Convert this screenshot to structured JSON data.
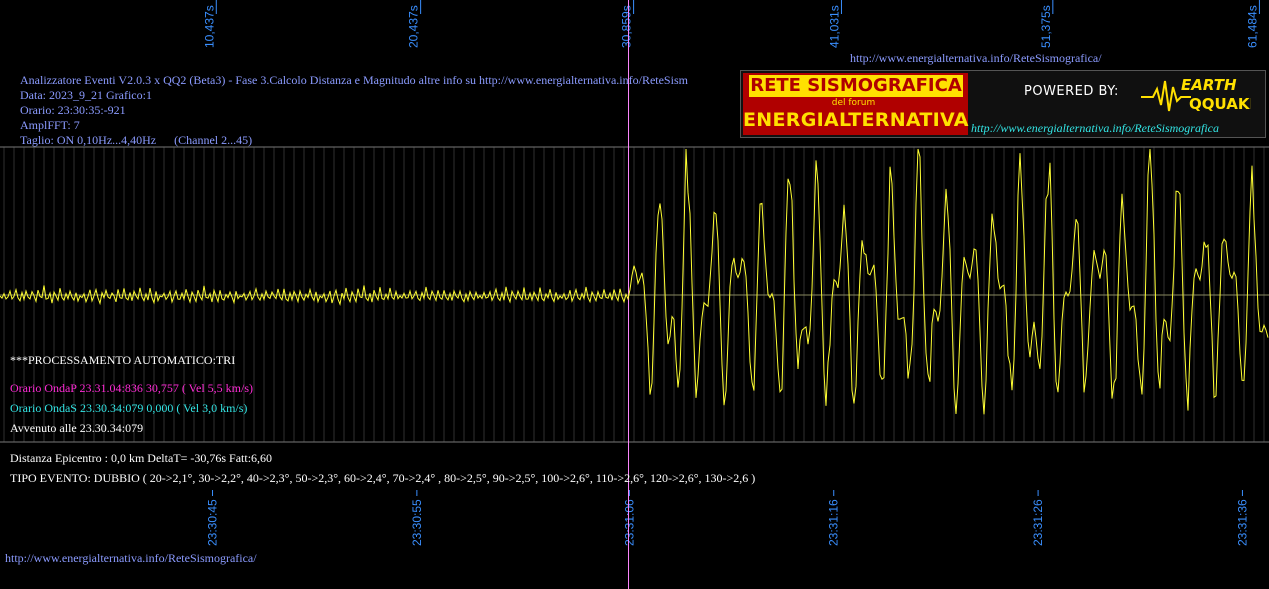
{
  "colors": {
    "background": "#000000",
    "trace": "#ffff33",
    "grid": "#555555",
    "axis_label": "#3a8fff",
    "pwave_marker": "#ff88ff",
    "header_text": "#8b9bff",
    "onda_p": "#ff2bd6",
    "onda_s": "#33e6e6"
  },
  "header": {
    "title": "Analizzatore Eventi V2.0.3 x QQ2 (Beta3) - Fase 3.Calcolo Distanza e Magnitudo altre info su http://www.energialternativa.info/ReteSism",
    "data": "Data: 2023_9_21 Grafico:1",
    "orario": "Orario: 23:30:35:-921",
    "ampl": "AmplFFT: 7",
    "taglio": "Taglio: ON 0,10Hz...4,40Hz      (Channel 2...45)",
    "top_url": "http://www.energialternativa.info/ReteSismografica/"
  },
  "logo": {
    "top": "RETE SISMOGRAFICA",
    "mid": "del forum",
    "bottom": "ENERGIALTERNATIVA",
    "powered": "POWERED BY:",
    "brand_line1": "EARTH",
    "brand_line2": "QQUAKE",
    "url": "http://www.energialternativa.info/ReteSismografica"
  },
  "processing": {
    "auto": "***PROCESSAMENTO AUTOMATICO:TRI",
    "onda_p": "Orario OndaP 23.31.04:836  30,757 ( Vel 5,5 km/s)",
    "onda_s": "Orario OndaS 23.30.34:079  0,000 ( Vel 3,0 km/s)",
    "avvenuto": "Avvenuto alle 23.30.34:079",
    "distanza": "Distanza Epicentro : 0,0 km DeltaT= -30,76s  Fatt:6,60",
    "tipo_evento": "TIPO EVENTO: DUBBIO ( 20->2,1°, 30->2,2°, 40->2,3°, 50->2,3°, 60->2,4°, 70->2,4° , 80->2,5°, 90->2,5°, 100->2,6°, 110->2,6°, 120->2,6°, 130->2,6 )"
  },
  "footer_url": "http://www.energialternativa.info/ReteSismografica/",
  "chart_data": {
    "type": "line",
    "series": [],
    "x_unit": "s",
    "x_range": [
      0,
      62.1
    ],
    "top_ticks": [
      "10,437s",
      "20,437s",
      "30,859s",
      "41,031s",
      "51,375s",
      "61,484s"
    ],
    "top_tick_values": [
      10.437,
      20.437,
      30.859,
      41.031,
      51.375,
      61.484
    ],
    "bottom_ticks": [
      "23:30:45",
      "23:30:55",
      "23:31:06",
      "23:31:16",
      "23:31:26",
      "23:31:36"
    ],
    "bottom_tick_values": [
      10.4,
      20.4,
      30.8,
      40.8,
      50.8,
      60.8
    ],
    "p_wave_marker_s": 30.757,
    "grid": true,
    "trace": {
      "pre_event_amplitude": 0.08,
      "post_event_amplitude": 1.0,
      "sample_interval_s": 0.1,
      "samples": [
        0.01,
        0.03,
        -0.02,
        0.05,
        0.02,
        -0.04,
        0.06,
        0.01,
        -0.05,
        0.03,
        0.07,
        -0.02,
        0.04,
        -0.06,
        0.02,
        0.05,
        -0.03,
        0.01,
        0.06,
        -0.05,
        0.02,
        0.04,
        -0.07,
        0.03,
        0.05,
        -0.02,
        0.06,
        -0.04,
        0.01,
        0.05,
        -0.06,
        0.03,
        0.07,
        -0.01,
        0.04,
        -0.05,
        0.02,
        0.06,
        -0.03,
        0.05
      ]
    }
  }
}
